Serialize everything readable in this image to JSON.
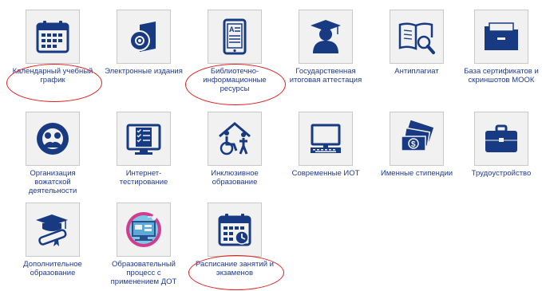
{
  "colors": {
    "icon": "#173a82",
    "label": "#1f3a93",
    "tile_bg": "#f1f1f1",
    "tile_border": "#c9c9c9",
    "highlight": "#e02020"
  },
  "tiles": [
    {
      "label": "Календарный учебный график",
      "icon": "calendar-icon",
      "highlighted": true
    },
    {
      "label": "Электронные издания",
      "icon": "disc-book-icon",
      "highlighted": false
    },
    {
      "label": "Библиотечно-информационные ресурсы",
      "icon": "tablet-reader-icon",
      "highlighted": true
    },
    {
      "label": "Государственная итоговая аттестация",
      "icon": "graduate-icon",
      "highlighted": false
    },
    {
      "label": "Антиплагиат",
      "icon": "book-magnifier-icon",
      "highlighted": false
    },
    {
      "label": "База сертификатов и скриншотов МООК",
      "icon": "folder-icon",
      "highlighted": false
    },
    {
      "label": "Организация вожатской деятельности",
      "icon": "people-circle-icon",
      "highlighted": false
    },
    {
      "label": "Интернет-тестирование",
      "icon": "checklist-monitor-icon",
      "highlighted": false
    },
    {
      "label": "Инклюзивное образование",
      "icon": "wheelchair-icon",
      "highlighted": false
    },
    {
      "label": "Современные ИОТ",
      "icon": "computer-icon",
      "highlighted": false
    },
    {
      "label": "Именные стипендии",
      "icon": "money-icon",
      "highlighted": false
    },
    {
      "label": "Трудоустройство",
      "icon": "briefcase-icon",
      "highlighted": false
    },
    {
      "label": "Дополнительное образование",
      "icon": "diploma-cap-icon",
      "highlighted": false
    },
    {
      "label": "Образовательный процесс с применением ДОТ",
      "icon": "distance-learning-icon",
      "highlighted": false
    },
    {
      "label": "Расписание занятий и экзаменов",
      "icon": "calendar-clock-icon",
      "highlighted": true
    }
  ]
}
